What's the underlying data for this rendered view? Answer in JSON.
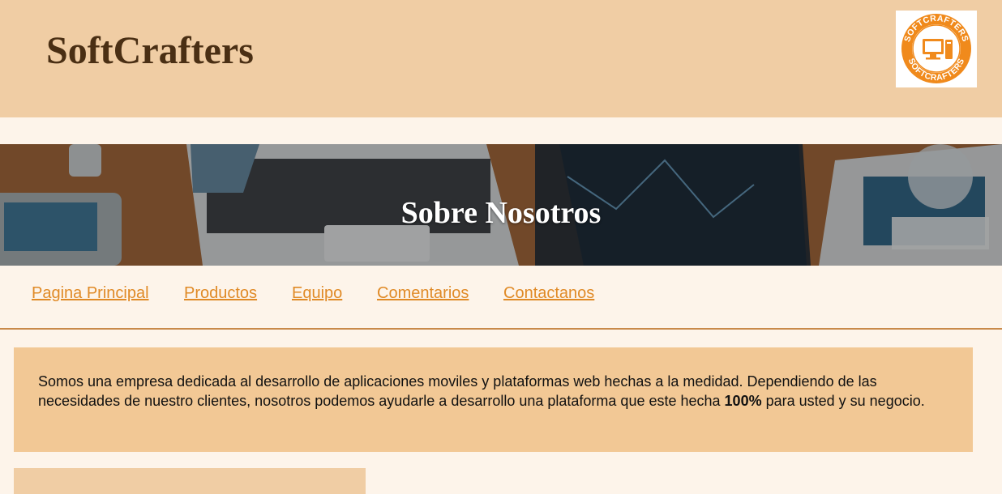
{
  "header": {
    "brand": "SoftCrafters",
    "logo_text_top": "SOFTCRAFTERS",
    "logo_text_bottom": "SOFTCRAFTERS"
  },
  "hero": {
    "title": "Sobre Nosotros"
  },
  "nav": {
    "items": [
      {
        "label": "Pagina Principal"
      },
      {
        "label": "Productos"
      },
      {
        "label": "Equipo"
      },
      {
        "label": "Comentarios"
      },
      {
        "label": "Contactanos"
      }
    ]
  },
  "about": {
    "text_before": "Somos una empresa dedicada al desarrollo de aplicaciones moviles y plataformas web hechas a la medidad. Dependiendo de las necesidades de nuestro clientes, nosotros podemos ayudarle a desarrollo una plataforma que este hecha ",
    "highlight": "100%",
    "text_after": " para usted y su negocio."
  },
  "colors": {
    "header_bg": "#f0cda4",
    "page_bg": "#fdf4ea",
    "brand_text": "#4a2f14",
    "nav_link": "#e08a26",
    "about_bg": "#f2c895",
    "logo_orange": "#f08a1c"
  },
  "icons": {
    "logo": "computer-monitor-icon"
  }
}
